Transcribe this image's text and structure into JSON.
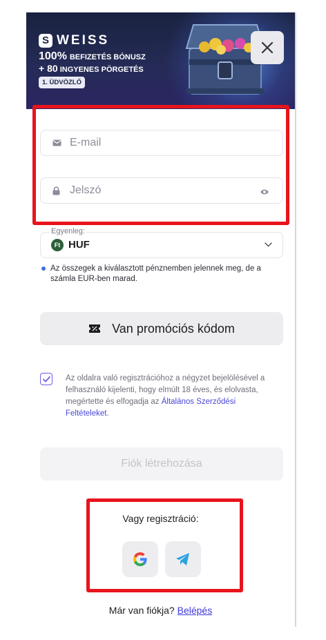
{
  "banner": {
    "brand": "WEISS",
    "logo_letter": "S",
    "line1_big": "100%",
    "line1_small": "BEFIZETÉS BÓNUSZ",
    "line2_prefix": "+ 80",
    "line2_small": "INGYENES PÖRGETÉS",
    "badge": "1. ÜDVÖZLŐ"
  },
  "form": {
    "email_placeholder": "E-mail",
    "password_placeholder": "Jelszó",
    "currency_label": "Egyenleg:",
    "currency_symbol": "Ft",
    "currency_value": "HUF",
    "currency_info": "Az összegek a kiválasztott pénznemben jelennek meg, de a számla EUR-ben marad.",
    "promo_button": "Van promóciós kódom",
    "terms_text": "Az oldalra való regisztrációhoz a négyzet bejelölésével a felhasználó kijelenti, hogy elmúlt 18 éves, és elolvasta, megértette és elfogadja az ",
    "terms_link": "Általános Szerződési Feltételeket",
    "terms_end": ".",
    "create_button": "Fiók létrehozása"
  },
  "social": {
    "or_text": "Vagy regisztráció:",
    "google_letter": "G"
  },
  "footer": {
    "have_account": "Már van fiókja?",
    "login_link": "Belépés"
  },
  "colors": {
    "highlight": "#e8141c",
    "accent": "#4a47d6",
    "banner_bg": "#252b56"
  }
}
